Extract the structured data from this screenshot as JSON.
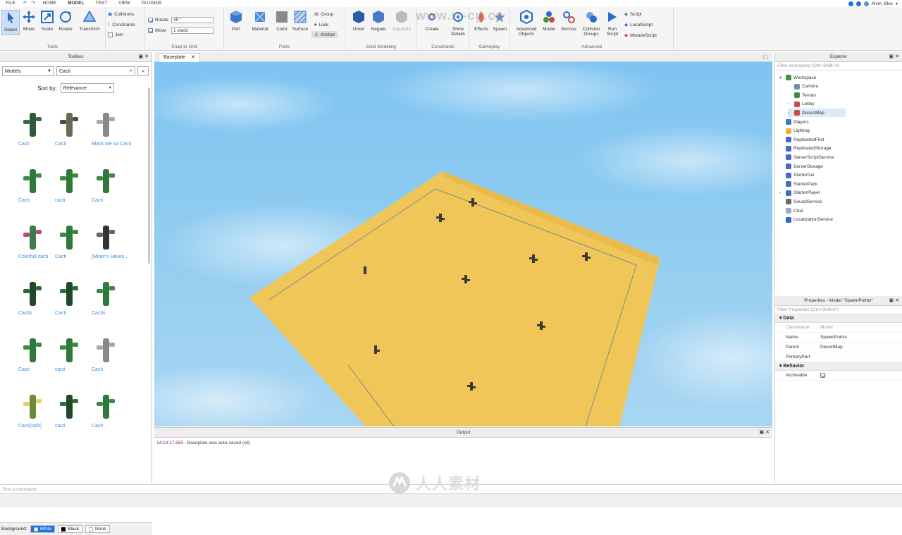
{
  "menubar": {
    "items": [
      "FILE",
      "HOME",
      "MODEL",
      "TEST",
      "VIEW",
      "PLUGINS"
    ],
    "active": "MODEL",
    "username": "Alvin_Blox",
    "watermark_url": "www.rr-cg.cn"
  },
  "ribbon": {
    "tools": {
      "label": "Tools",
      "items": [
        "Select",
        "Move",
        "Scale",
        "Rotate",
        "Transform"
      ]
    },
    "collisions": [
      "Collisions",
      "Constraints",
      "Join"
    ],
    "snap": {
      "label": "Snap to Grid",
      "rotate_label": "Rotate",
      "rotate_value": "45 °",
      "move_label": "Move",
      "move_value": "1 studs"
    },
    "parts": {
      "label": "Parts",
      "items": [
        "Part",
        "Material",
        "Color",
        "Surface"
      ],
      "side": [
        "Group",
        "Lock",
        "Anchor"
      ]
    },
    "solid": {
      "label": "Solid Modeling",
      "items": [
        "Union",
        "Negate",
        "Separate"
      ]
    },
    "constraints": {
      "label": "Constraints",
      "items": [
        "Create",
        "Show Details"
      ]
    },
    "gameplay": {
      "label": "Gameplay",
      "items": [
        "Effects",
        "Spawn"
      ]
    },
    "advanced": {
      "label": "Advanced",
      "items": [
        "Advanced Objects",
        "Model",
        "Service",
        "Collision Groups",
        "Run Script"
      ],
      "scripts": [
        "Script",
        "LocalScript",
        "ModuleScript"
      ]
    }
  },
  "toolbox": {
    "title": "Toolbox",
    "category": "Models",
    "search": "Cacti",
    "sort_label": "Sort by:",
    "sort_value": "Relevance",
    "items": [
      "Cacti",
      "Cacti",
      "Black Me sa Cacti",
      "Cacti",
      "cacti",
      "Cacti",
      "Colorfull cacti",
      "Cacti",
      "[Miner's Haven...",
      "Cactis",
      "Cacti",
      "Cactis",
      "Cacti",
      "cacti",
      "Cacti",
      "Cacti(split)",
      "cacti",
      "Cacti"
    ],
    "background_label": "Background:",
    "backgrounds": [
      "White",
      "Black",
      "None"
    ]
  },
  "viewport": {
    "tab": "Baseplate"
  },
  "output": {
    "title": "Output",
    "time": "14:14:17.555",
    "message": "- Baseplate was auto-saved (x8)"
  },
  "explorer": {
    "title": "Explorer",
    "filter_placeholder": "Filter workspace (Ctrl+Shift+X)",
    "items": [
      {
        "label": "Workspace",
        "color": "#3a9a3a"
      },
      {
        "label": "Camera",
        "color": "#7a8a99"
      },
      {
        "label": "Terrain",
        "color": "#3d8a4a"
      },
      {
        "label": "Lobby",
        "color": "#c84a4a"
      },
      {
        "label": "DesertMap",
        "color": "#c84a4a"
      },
      {
        "label": "Players",
        "color": "#3a78c8"
      },
      {
        "label": "Lighting",
        "color": "#e8b42a"
      },
      {
        "label": "ReplicatedFirst",
        "color": "#4a6ac8"
      },
      {
        "label": "ReplicatedStorage",
        "color": "#4a6ac8"
      },
      {
        "label": "ServerScriptService",
        "color": "#4a6ac8"
      },
      {
        "label": "ServerStorage",
        "color": "#4a6ac8"
      },
      {
        "label": "StarterGui",
        "color": "#4a6ac8"
      },
      {
        "label": "StarterPack",
        "color": "#4a6ac8"
      },
      {
        "label": "StarterPlayer",
        "color": "#4a6ac8"
      },
      {
        "label": "SoundService",
        "color": "#6a6a6a"
      },
      {
        "label": "Chat",
        "color": "#9aaac8"
      },
      {
        "label": "LocalizationService",
        "color": "#2a6ac8"
      }
    ]
  },
  "properties": {
    "title": "Properties - Model \"SpawnPoints\"",
    "filter_placeholder": "Filter Properties (Ctrl+Shift+P)",
    "sections": [
      {
        "name": "Data",
        "rows": [
          {
            "key": "ClassName",
            "value": "Model"
          },
          {
            "key": "Name",
            "value": "SpawnPoints"
          },
          {
            "key": "Parent",
            "value": "DesertMap"
          },
          {
            "key": "PrimaryPart",
            "value": ""
          }
        ]
      },
      {
        "name": "Behavior",
        "rows": [
          {
            "key": "Archivable",
            "value": ""
          }
        ]
      }
    ]
  },
  "command": {
    "placeholder": "Run a command"
  },
  "brand": {
    "text": "人人素材"
  }
}
